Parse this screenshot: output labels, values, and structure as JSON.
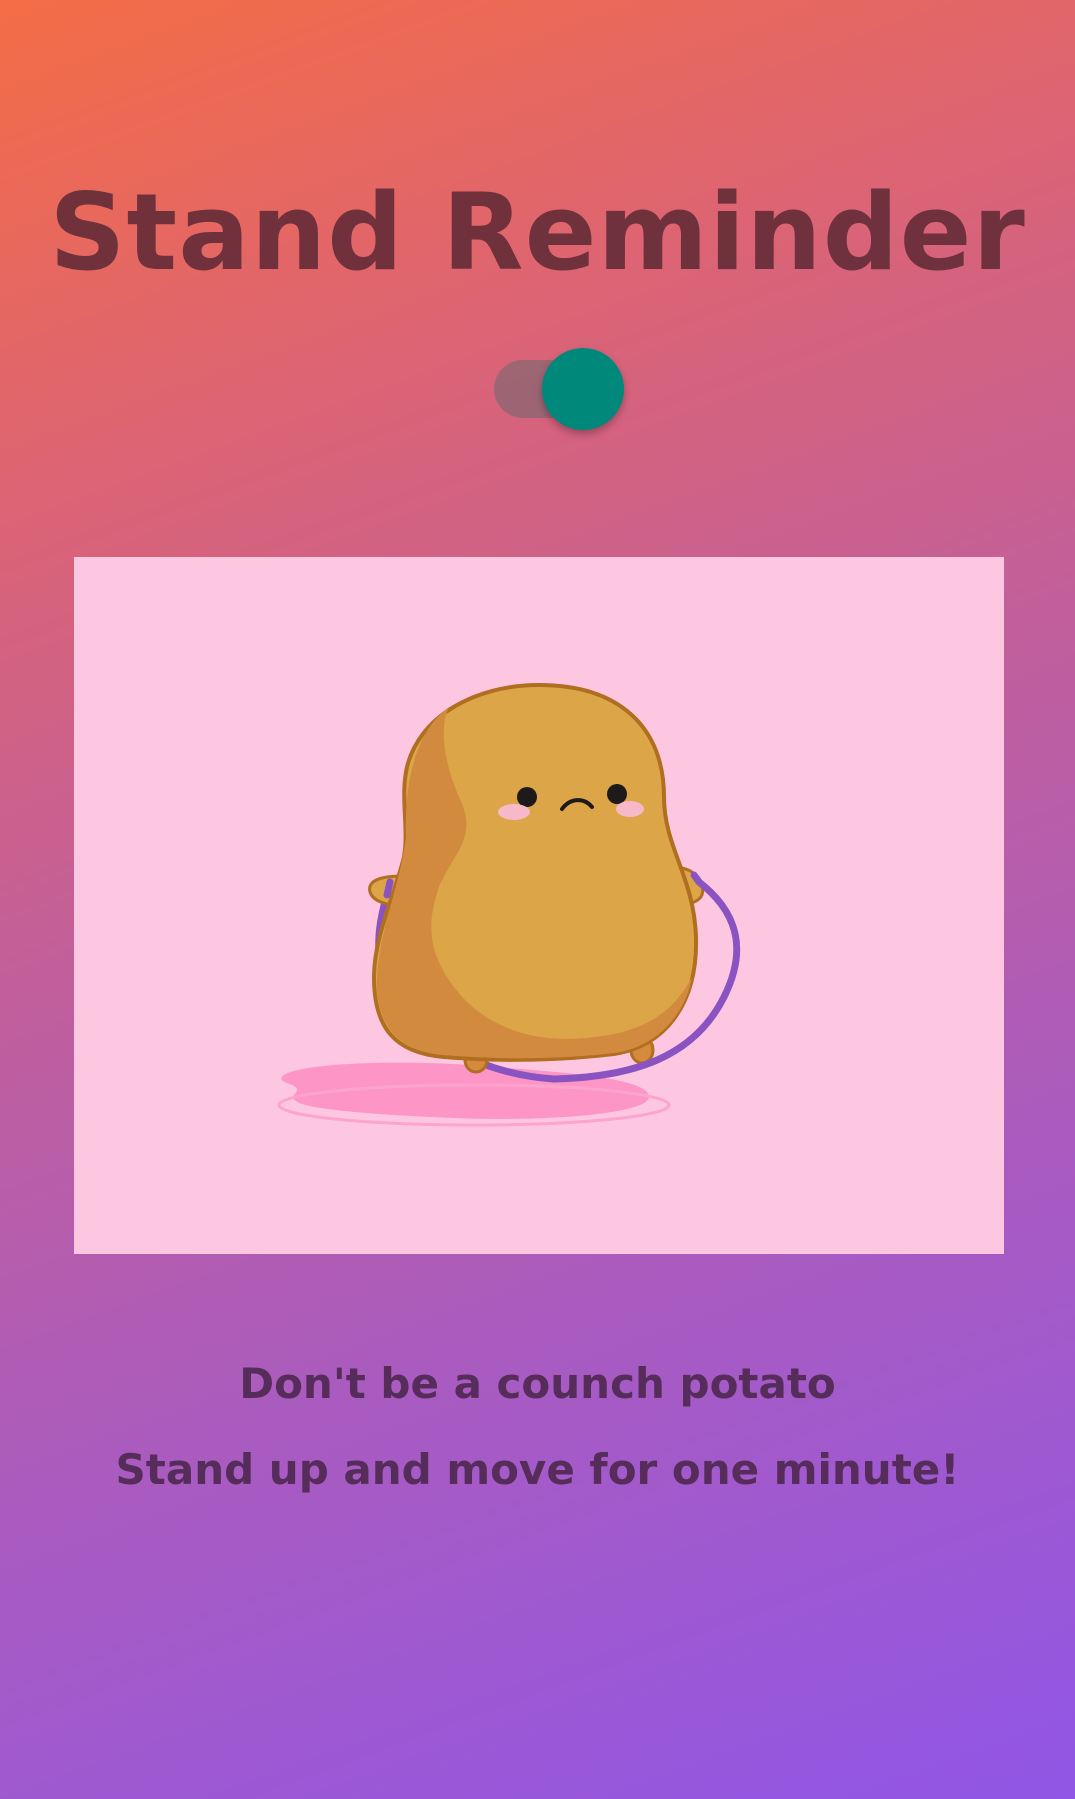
{
  "app": {
    "title": "Stand Reminder"
  },
  "toggle": {
    "state": "on",
    "knob_color": "#00897b",
    "track_color": "#6e6870"
  },
  "illustration": {
    "icon": "potato-jump-rope-illustration",
    "background_color": "#fec7e1"
  },
  "messages": {
    "line1": "Don't be a counch potato",
    "line2": "Stand up and move for one minute!"
  },
  "colors": {
    "title": "#6a2f3a",
    "message": "#562c5a",
    "gradient_start": "#f46d45",
    "gradient_end": "#9156e6"
  }
}
